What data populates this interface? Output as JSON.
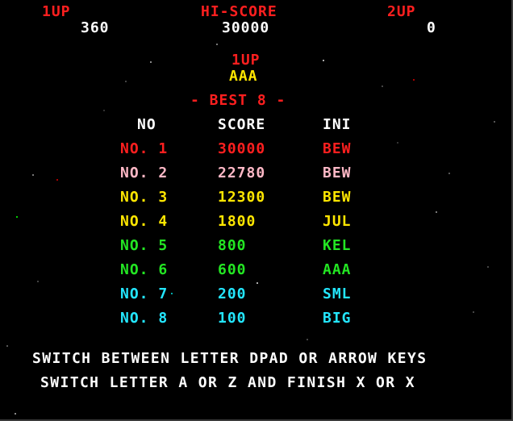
{
  "header": {
    "p1_label": "1UP",
    "p1_score": "360",
    "hi_label": "HI-SCORE",
    "hi_score": "30000",
    "p2_label": "2UP",
    "p2_score": "0"
  },
  "entry": {
    "player_label": "1UP",
    "initials": "AAA"
  },
  "table": {
    "title": "- BEST 8 -",
    "col_no": "NO",
    "col_score": "SCORE",
    "col_ini": "INI",
    "rows": [
      {
        "no": "NO. 1",
        "score": "30000",
        "ini": "BEW",
        "color": "#ff1f1f"
      },
      {
        "no": "NO. 2",
        "score": "22780",
        "ini": "BEW",
        "color": "#ffb8c6"
      },
      {
        "no": "NO. 3",
        "score": "12300",
        "ini": "BEW",
        "color": "#ffe600"
      },
      {
        "no": "NO. 4",
        "score": "1800",
        "ini": "JUL",
        "color": "#ffe600"
      },
      {
        "no": "NO. 5",
        "score": "800",
        "ini": "KEL",
        "color": "#23e623"
      },
      {
        "no": "NO. 6",
        "score": "600",
        "ini": "AAA",
        "color": "#23e623"
      },
      {
        "no": "NO. 7",
        "score": "200",
        "ini": "SML",
        "color": "#23e6ff"
      },
      {
        "no": "NO. 8",
        "score": "100",
        "ini": "BIG",
        "color": "#23e6ff"
      }
    ]
  },
  "instructions": {
    "line1": "SWITCH BETWEEN LETTER DPAD OR ARROW KEYS",
    "line2": "SWITCH LETTER A OR Z AND FINISH X OR X"
  },
  "colors": {
    "background": "#000000",
    "label_red": "#ff1f1f",
    "score_white": "#ffffff",
    "initials_yellow": "#ffe600"
  }
}
